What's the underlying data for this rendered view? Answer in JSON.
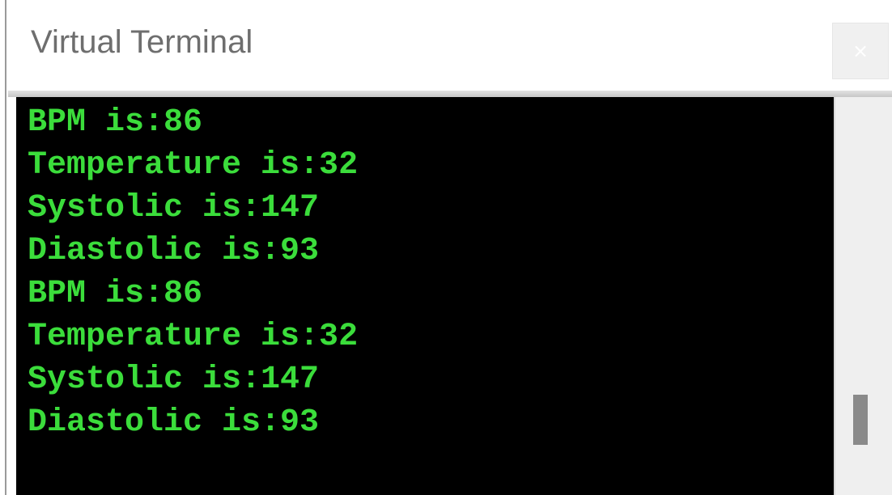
{
  "window": {
    "title": "Virtual Terminal",
    "close_icon": "close-icon",
    "close_glyph": "×"
  },
  "terminal": {
    "text_color": "#3bdd3b",
    "background": "#000000",
    "lines": [
      "BPM is:86",
      "Temperature is:32",
      "Systolic is:147",
      "Diastolic is:93",
      "BPM is:86",
      "Temperature is:32",
      "Systolic is:147",
      "Diastolic is:93"
    ]
  }
}
